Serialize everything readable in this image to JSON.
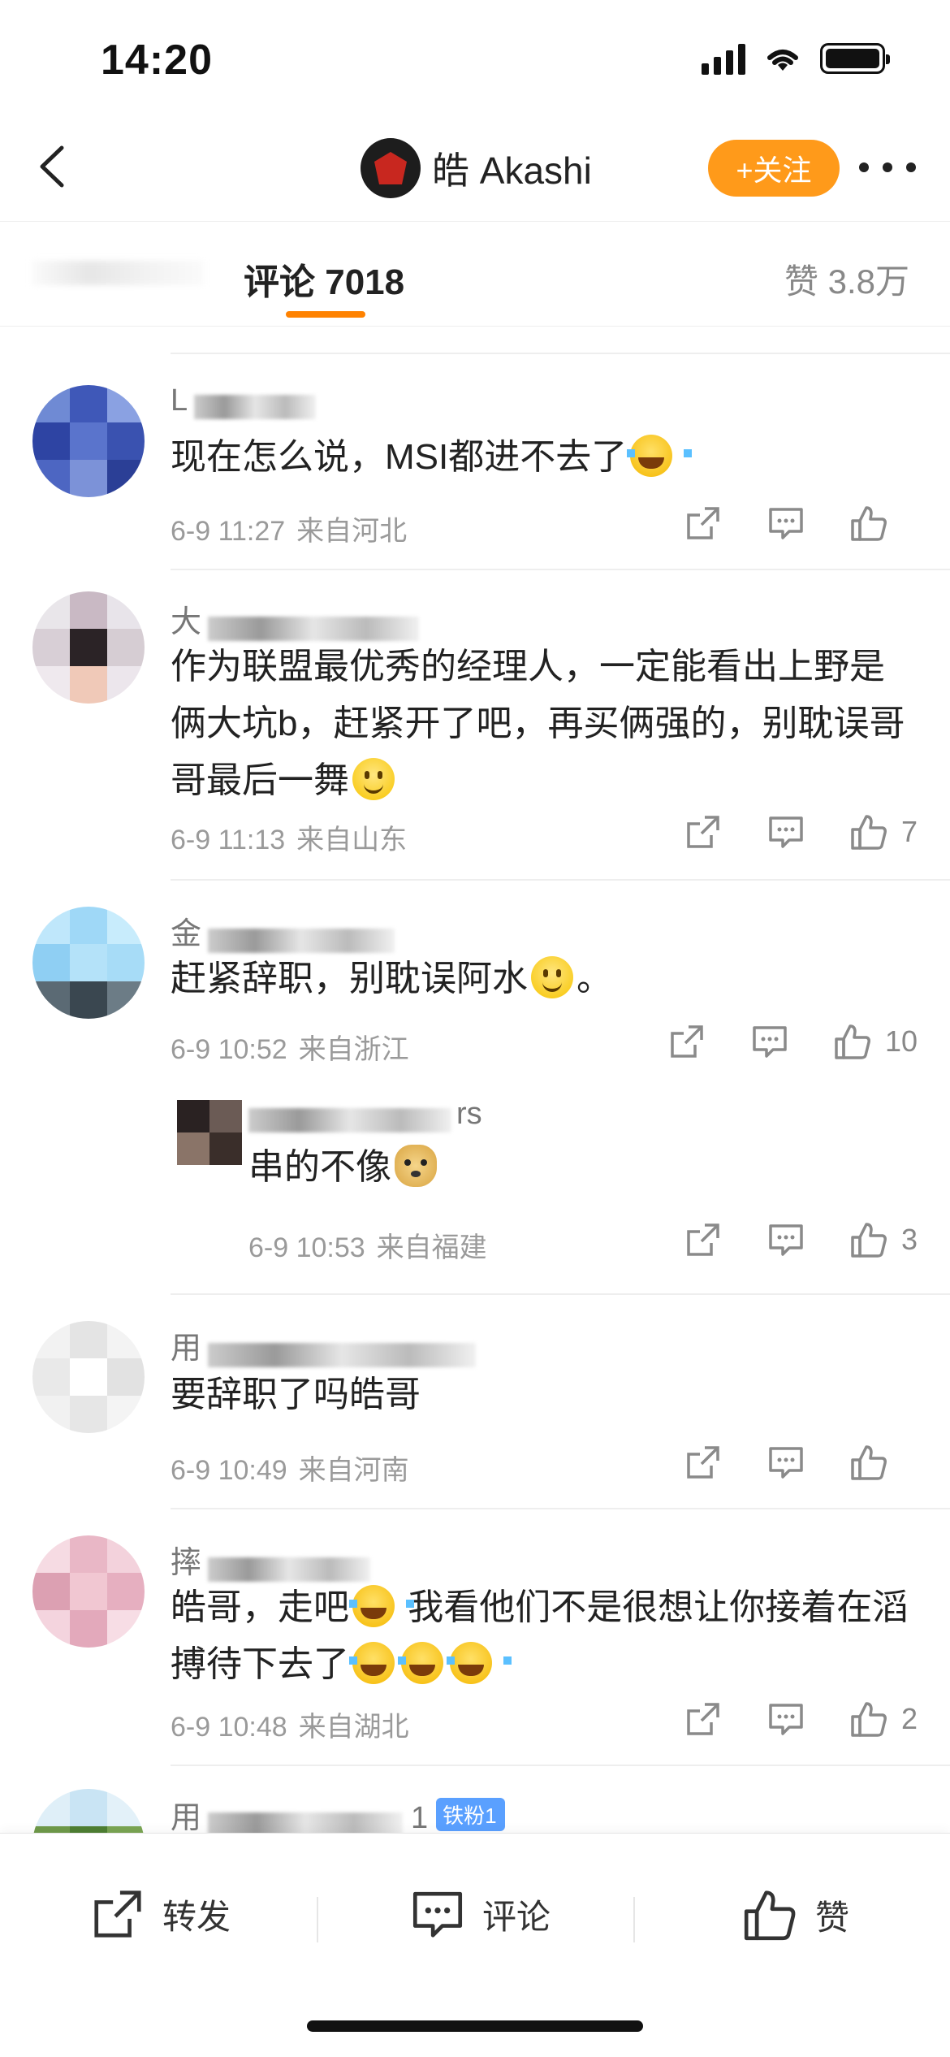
{
  "status_bar": {
    "time": "14:20"
  },
  "header": {
    "title": "皓 Akashi",
    "follow_label": "+关注"
  },
  "tabs": {
    "active_label": "评论 7018",
    "likes_label": "赞 3.8万"
  },
  "comments": [
    {
      "name_visible": "L",
      "text_parts": [
        "现在怎么说，MSI都进不去了"
      ],
      "emojis": [
        "laugh-cry"
      ],
      "date": "6-9 11:27",
      "location": "来自河北",
      "likes": ""
    },
    {
      "name_visible": "大",
      "text_parts": [
        "作为联盟最优秀的经理人，一定能看出上野是俩大坑b，赶紧开了吧，再买俩强的，别耽误哥哥最后一舞"
      ],
      "emojis": [
        "smile"
      ],
      "date": "6-9 11:13",
      "location": "来自山东",
      "likes": "7"
    },
    {
      "name_visible": "金",
      "text_parts": [
        "赶紧辞职，别耽误阿水",
        "。"
      ],
      "emojis": [
        "smile"
      ],
      "date": "6-9 10:52",
      "location": "来自浙江",
      "likes": "10",
      "reply": {
        "name_visible": "rs",
        "text": "串的不像",
        "emoji": "doge",
        "date": "6-9 10:53",
        "location": "来自福建",
        "likes": "3"
      }
    },
    {
      "name_visible": "用",
      "text_parts": [
        "要辞职了吗皓哥"
      ],
      "date": "6-9 10:49",
      "location": "来自河南",
      "likes": ""
    },
    {
      "name_visible": "摔",
      "text_parts": [
        "皓哥，走吧",
        " 我看他们不是很想让你接着在滔搏待下去了"
      ],
      "emojis": [
        "laugh-cry",
        "laugh-cry",
        "laugh-cry",
        "laugh-cry"
      ],
      "date": "6-9 10:48",
      "location": "来自湖北",
      "likes": "2"
    },
    {
      "name_visible": "用",
      "name_suffix": "1",
      "badge": "铁粉1"
    }
  ],
  "bottom_bar": {
    "repost_label": "转发",
    "comment_label": "评论",
    "like_label": "赞"
  },
  "colors": {
    "accent": "#ff8200",
    "follow_button": "#ff9a1a",
    "meta_text": "#9a9a9a",
    "badge": "#5aa0ff"
  },
  "icons": [
    "back-arrow-icon",
    "more-icon",
    "share-icon",
    "comment-icon",
    "like-icon",
    "signal-icon",
    "wifi-icon",
    "battery-icon"
  ]
}
